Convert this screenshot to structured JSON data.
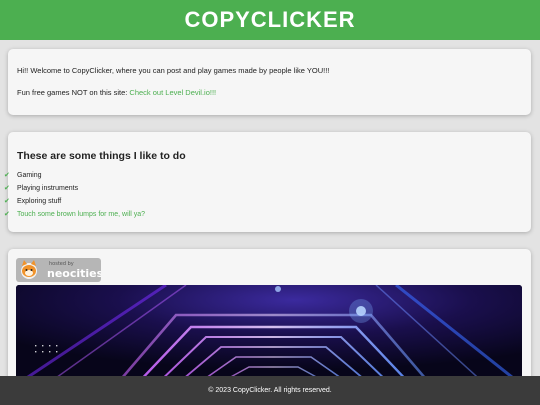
{
  "header": {
    "title": "COPYCLICKER"
  },
  "intro": {
    "welcome": "Hi!! Welcome to CopyClicker, where you can post and play games made by people like YOU!!!",
    "games_prefix": "Fun free games NOT on this site: ",
    "games_link": "Check out Level Devil.io!!!"
  },
  "likes": {
    "heading": "These are some things I like to do",
    "items": [
      {
        "label": "Gaming",
        "link": false
      },
      {
        "label": "Playing instruments",
        "link": false
      },
      {
        "label": "Exploring stuff",
        "link": false
      },
      {
        "label": "Touch some brown lumps for me, will ya?",
        "link": true
      }
    ]
  },
  "badge": {
    "small": "hosted by",
    "big": "neocities"
  },
  "footer": {
    "copyright": "© 2023 CopyClicker. All rights reserved."
  },
  "colors": {
    "accent": "#4caf50",
    "footer_bg": "#3b3b3b",
    "card_bg": "#f6f6f6"
  }
}
